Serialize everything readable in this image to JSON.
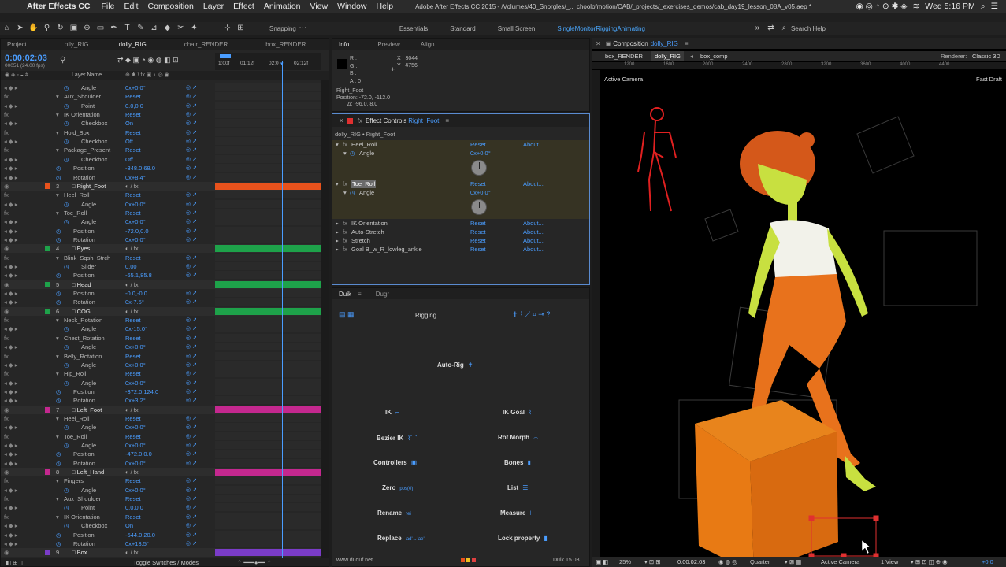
{
  "menubar": {
    "app": "After Effects CC",
    "menus": [
      "File",
      "Edit",
      "Composition",
      "Layer",
      "Effect",
      "Animation",
      "View",
      "Window",
      "Help"
    ],
    "doc_title": "Adobe After Effects CC 2015 - /Volumes/40_Snorgles/_... choolofmotion/CAB/_projects/_exercises_demos/cab_day19_lesson_08A_v05.aep *",
    "clock": "Wed 5:16 PM"
  },
  "toolbar": {
    "snapping": "Snapping",
    "workspaces": [
      "Essentials",
      "Standard",
      "Small Screen",
      "SingleMonitorRiggingAnimating"
    ],
    "search": "Search Help"
  },
  "timeline": {
    "tabs": [
      "Project",
      "olly_RIG",
      "dolly_RIG",
      "chair_RENDER",
      "box_RENDER"
    ],
    "timecode": "0:00:02:03",
    "fps": "00051 (24.00 fps)",
    "col_header": "Layer Name",
    "ruler": [
      "1:00f",
      "01:12f",
      "02:0",
      "02:12f"
    ],
    "footer": "Toggle Switches / Modes",
    "rows": [
      {
        "k": "p",
        "i": 3,
        "n": "Angle",
        "v": "0x+0.0°"
      },
      {
        "k": "g",
        "i": 2,
        "n": "Aux_Shoulder",
        "v": "Reset"
      },
      {
        "k": "p",
        "i": 3,
        "n": "Point",
        "v": "0.0,0.0"
      },
      {
        "k": "g",
        "i": 2,
        "n": "IK Orientation",
        "v": "Reset"
      },
      {
        "k": "p",
        "i": 3,
        "n": "Checkbox",
        "v": "On"
      },
      {
        "k": "g",
        "i": 2,
        "n": "Hold_Box",
        "v": "Reset"
      },
      {
        "k": "p",
        "i": 3,
        "n": "Checkbox",
        "v": "Off"
      },
      {
        "k": "g",
        "i": 2,
        "n": "Package_Present",
        "v": "Reset"
      },
      {
        "k": "p",
        "i": 3,
        "n": "Checkbox",
        "v": "Off"
      },
      {
        "k": "p",
        "i": 2,
        "n": "Position",
        "v": "-348.0,68.0"
      },
      {
        "k": "p",
        "i": 2,
        "n": "Rotation",
        "v": "0x+8.4°"
      },
      {
        "k": "L",
        "num": "3",
        "n": "Right_Foot",
        "c": "#e8521c"
      },
      {
        "k": "g",
        "i": 2,
        "n": "Heel_Roll",
        "v": "Reset"
      },
      {
        "k": "p",
        "i": 3,
        "n": "Angle",
        "v": "0x+0.0°"
      },
      {
        "k": "g",
        "i": 2,
        "n": "Toe_Roll",
        "v": "Reset"
      },
      {
        "k": "p",
        "i": 3,
        "n": "Angle",
        "v": "0x+0.0°"
      },
      {
        "k": "p",
        "i": 2,
        "n": "Position",
        "v": "-72.0,0.0"
      },
      {
        "k": "p",
        "i": 2,
        "n": "Rotation",
        "v": "0x+0.0°"
      },
      {
        "k": "L",
        "num": "4",
        "n": "Eyes",
        "c": "#1ea24a"
      },
      {
        "k": "g",
        "i": 2,
        "n": "Blink_Sqsh_Strch",
        "v": "Reset"
      },
      {
        "k": "p",
        "i": 3,
        "n": "Slider",
        "v": "0.00"
      },
      {
        "k": "p",
        "i": 2,
        "n": "Position",
        "v": "-65.1,85.8"
      },
      {
        "k": "L",
        "num": "5",
        "n": "Head",
        "c": "#1ea24a"
      },
      {
        "k": "p",
        "i": 2,
        "n": "Position",
        "v": "-0.0,-0.0"
      },
      {
        "k": "p",
        "i": 2,
        "n": "Rotation",
        "v": "0x-7.5°"
      },
      {
        "k": "L",
        "num": "6",
        "n": "COG",
        "c": "#1ea24a"
      },
      {
        "k": "g",
        "i": 2,
        "n": "Neck_Rotation",
        "v": "Reset"
      },
      {
        "k": "p",
        "i": 3,
        "n": "Angle",
        "v": "0x-15.0°"
      },
      {
        "k": "g",
        "i": 2,
        "n": "Chest_Rotation",
        "v": "Reset"
      },
      {
        "k": "p",
        "i": 3,
        "n": "Angle",
        "v": "0x+0.0°"
      },
      {
        "k": "g",
        "i": 2,
        "n": "Belly_Rotation",
        "v": "Reset"
      },
      {
        "k": "p",
        "i": 3,
        "n": "Angle",
        "v": "0x+0.0°"
      },
      {
        "k": "g",
        "i": 2,
        "n": "Hip_Roll",
        "v": "Reset"
      },
      {
        "k": "p",
        "i": 3,
        "n": "Angle",
        "v": "0x+0.0°"
      },
      {
        "k": "p",
        "i": 2,
        "n": "Position",
        "v": "-372.0,124.0"
      },
      {
        "k": "p",
        "i": 2,
        "n": "Rotation",
        "v": "0x+3.2°"
      },
      {
        "k": "L",
        "num": "7",
        "n": "Left_Foot",
        "c": "#c4288f"
      },
      {
        "k": "g",
        "i": 2,
        "n": "Heel_Roll",
        "v": "Reset"
      },
      {
        "k": "p",
        "i": 3,
        "n": "Angle",
        "v": "0x+0.0°"
      },
      {
        "k": "g",
        "i": 2,
        "n": "Toe_Roll",
        "v": "Reset"
      },
      {
        "k": "p",
        "i": 3,
        "n": "Angle",
        "v": "0x+0.0°"
      },
      {
        "k": "p",
        "i": 2,
        "n": "Position",
        "v": "-472.0,0.0"
      },
      {
        "k": "p",
        "i": 2,
        "n": "Rotation",
        "v": "0x+0.0°"
      },
      {
        "k": "L",
        "num": "8",
        "n": "Left_Hand",
        "c": "#c4288f"
      },
      {
        "k": "g",
        "i": 2,
        "n": "Fingers",
        "v": "Reset"
      },
      {
        "k": "p",
        "i": 3,
        "n": "Angle",
        "v": "0x+0.0°"
      },
      {
        "k": "g",
        "i": 2,
        "n": "Aux_Shoulder",
        "v": "Reset"
      },
      {
        "k": "p",
        "i": 3,
        "n": "Point",
        "v": "0.0,0.0"
      },
      {
        "k": "g",
        "i": 2,
        "n": "IK Orientation",
        "v": "Reset"
      },
      {
        "k": "p",
        "i": 3,
        "n": "Checkbox",
        "v": "On"
      },
      {
        "k": "p",
        "i": 2,
        "n": "Position",
        "v": "-544.0,20.0"
      },
      {
        "k": "p",
        "i": 2,
        "n": "Rotation",
        "v": "0x+13.5°"
      },
      {
        "k": "L",
        "num": "9",
        "n": "Box",
        "c": "#7a3cc8"
      }
    ]
  },
  "info": {
    "tabs": [
      "Info",
      "Preview",
      "Align"
    ],
    "rgba": [
      "R :",
      "G :",
      "B :",
      "A : 0"
    ],
    "x": "X : 3044",
    "y": "Y : 4756",
    "layer": "Right_Foot",
    "position": "Position: -72.0, -112.0",
    "delta": "Δ: -96.0, 8.0"
  },
  "effects": {
    "title": "Effect Controls",
    "layer": "Right_Foot",
    "path": "dolly_RIG • Right_Foot",
    "reset": "Reset",
    "about": "About...",
    "heel": "Heel_Roll",
    "toe": "Toe_Roll",
    "angle": "Angle",
    "angle_val": "0x+0.0°",
    "others": [
      "IK Orientation",
      "Auto-Stretch",
      "Stretch",
      "Goal B_w_R_lowleg_ankle"
    ]
  },
  "duik": {
    "tabs": [
      "Duik",
      "Dugr"
    ],
    "section": "Rigging",
    "autorig": "Auto-Rig",
    "left": [
      "IK",
      "Bezier IK",
      "Controllers",
      "Zero",
      "Rename",
      "Replace"
    ],
    "right": [
      "IK Goal",
      "Rot Morph",
      "Bones",
      "List",
      "Measure",
      "Lock property"
    ],
    "zero_glyph": "pos(0)",
    "rename_glyph": "rei",
    "replace_glyph": "'ad'→'ae'",
    "url": "www.duduf.net",
    "version": "Duik 15.08"
  },
  "comp": {
    "tab": "Composition",
    "name": "dolly_RIG",
    "crumbs": [
      "box_RENDER",
      "dolly_RIG",
      "box_comp"
    ],
    "renderer": "Renderer:",
    "renderer_val": "Classic 3D",
    "camera": "Active Camera",
    "quality": "Fast Draft",
    "ruler": [
      "1200",
      "1600",
      "2000",
      "2400",
      "2800",
      "3200",
      "3600",
      "4000",
      "4400"
    ],
    "footer": {
      "zoom": "25%",
      "time": "0:00:02:03",
      "res": "Quarter",
      "cam": "Active Camera",
      "views": "1 View",
      "exp": "+0.0"
    }
  },
  "colors": {
    "accent": "#4a9dff",
    "orange": "#e8521c",
    "green": "#1ea24a",
    "magenta": "#c4288f",
    "purple": "#7a3cc8"
  }
}
